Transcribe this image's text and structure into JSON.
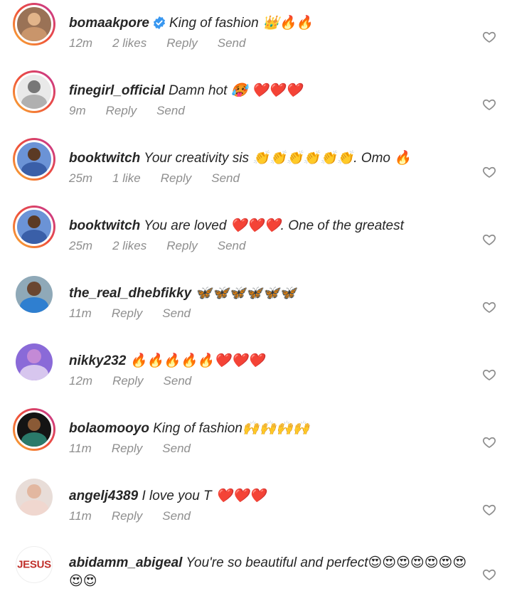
{
  "comments": [
    {
      "username": "bomaakpore",
      "verified": true,
      "text": "King of fashion 👑🔥🔥",
      "time": "12m",
      "likes": "2 likes",
      "reply": "Reply",
      "send": "Send",
      "avatar": {
        "ring": "story",
        "bg": "#9a7256",
        "head": "#e2b48a",
        "body": "#c9956b"
      }
    },
    {
      "username": "finegirl_official",
      "verified": false,
      "text": "Damn hot 🥵 ❤️❤️❤️",
      "time": "9m",
      "likes": "",
      "reply": "Reply",
      "send": "Send",
      "avatar": {
        "ring": "story",
        "bg": "#e9e9e9",
        "head": "#777777",
        "body": "#b0b0b0"
      }
    },
    {
      "username": "booktwitch",
      "verified": false,
      "text": "Your creativity sis 👏👏👏👏👏👏. Omo 🔥",
      "time": "25m",
      "likes": "1 like",
      "reply": "Reply",
      "send": "Send",
      "avatar": {
        "ring": "story",
        "bg": "#6b93d6",
        "head": "#5b3a24",
        "body": "#3a5fa8"
      }
    },
    {
      "username": "booktwitch",
      "verified": false,
      "text": "You are loved ❤️❤️❤️. One of the greatest",
      "time": "25m",
      "likes": "2 likes",
      "reply": "Reply",
      "send": "Send",
      "avatar": {
        "ring": "story",
        "bg": "#6b93d6",
        "head": "#5b3a24",
        "body": "#3a5fa8"
      }
    },
    {
      "username": "the_real_dhebfikky",
      "verified": false,
      "text": "🦋🦋🦋🦋🦋🦋",
      "time": "11m",
      "likes": "",
      "reply": "Reply",
      "send": "Send",
      "avatar": {
        "ring": "plain",
        "bg": "#8fa9b8",
        "head": "#6a4630",
        "body": "#2f7fd0"
      }
    },
    {
      "username": "nikky232",
      "verified": false,
      "text": "🔥🔥🔥🔥🔥❤️❤️❤️",
      "time": "12m",
      "likes": "",
      "reply": "Reply",
      "send": "Send",
      "avatar": {
        "ring": "plain",
        "bg": "#8a6ad8",
        "head": "#c48ad6",
        "body": "#d7c6ee"
      }
    },
    {
      "username": "bolaomooyo",
      "verified": false,
      "text": "King of fashion🙌🙌🙌🙌",
      "time": "11m",
      "likes": "",
      "reply": "Reply",
      "send": "Send",
      "avatar": {
        "ring": "story",
        "bg": "#141414",
        "head": "#8a5a36",
        "body": "#2a7a6a"
      }
    },
    {
      "username": "angelj4389",
      "verified": false,
      "text": "I love you T ❤️❤️❤️",
      "time": "11m",
      "likes": "",
      "reply": "Reply",
      "send": "Send",
      "avatar": {
        "ring": "plain",
        "bg": "#e8ddd8",
        "head": "#e2b7a0",
        "body": "#f0d7cf"
      }
    },
    {
      "username": "abidamm_abigeal",
      "verified": false,
      "text": "You're so beautiful and perfect😍😍😍😍😍😍😍😍😍",
      "time": "",
      "likes": "",
      "reply": "",
      "send": "",
      "avatar": {
        "ring": "plain",
        "bg": "#ffffff",
        "label": "JESUS"
      }
    }
  ],
  "icons": {
    "heart": "heart-icon",
    "verified": "verified-badge-icon"
  },
  "colors": {
    "verified": "#3897f0",
    "meta": "#8e8e8e",
    "text": "#262626"
  }
}
